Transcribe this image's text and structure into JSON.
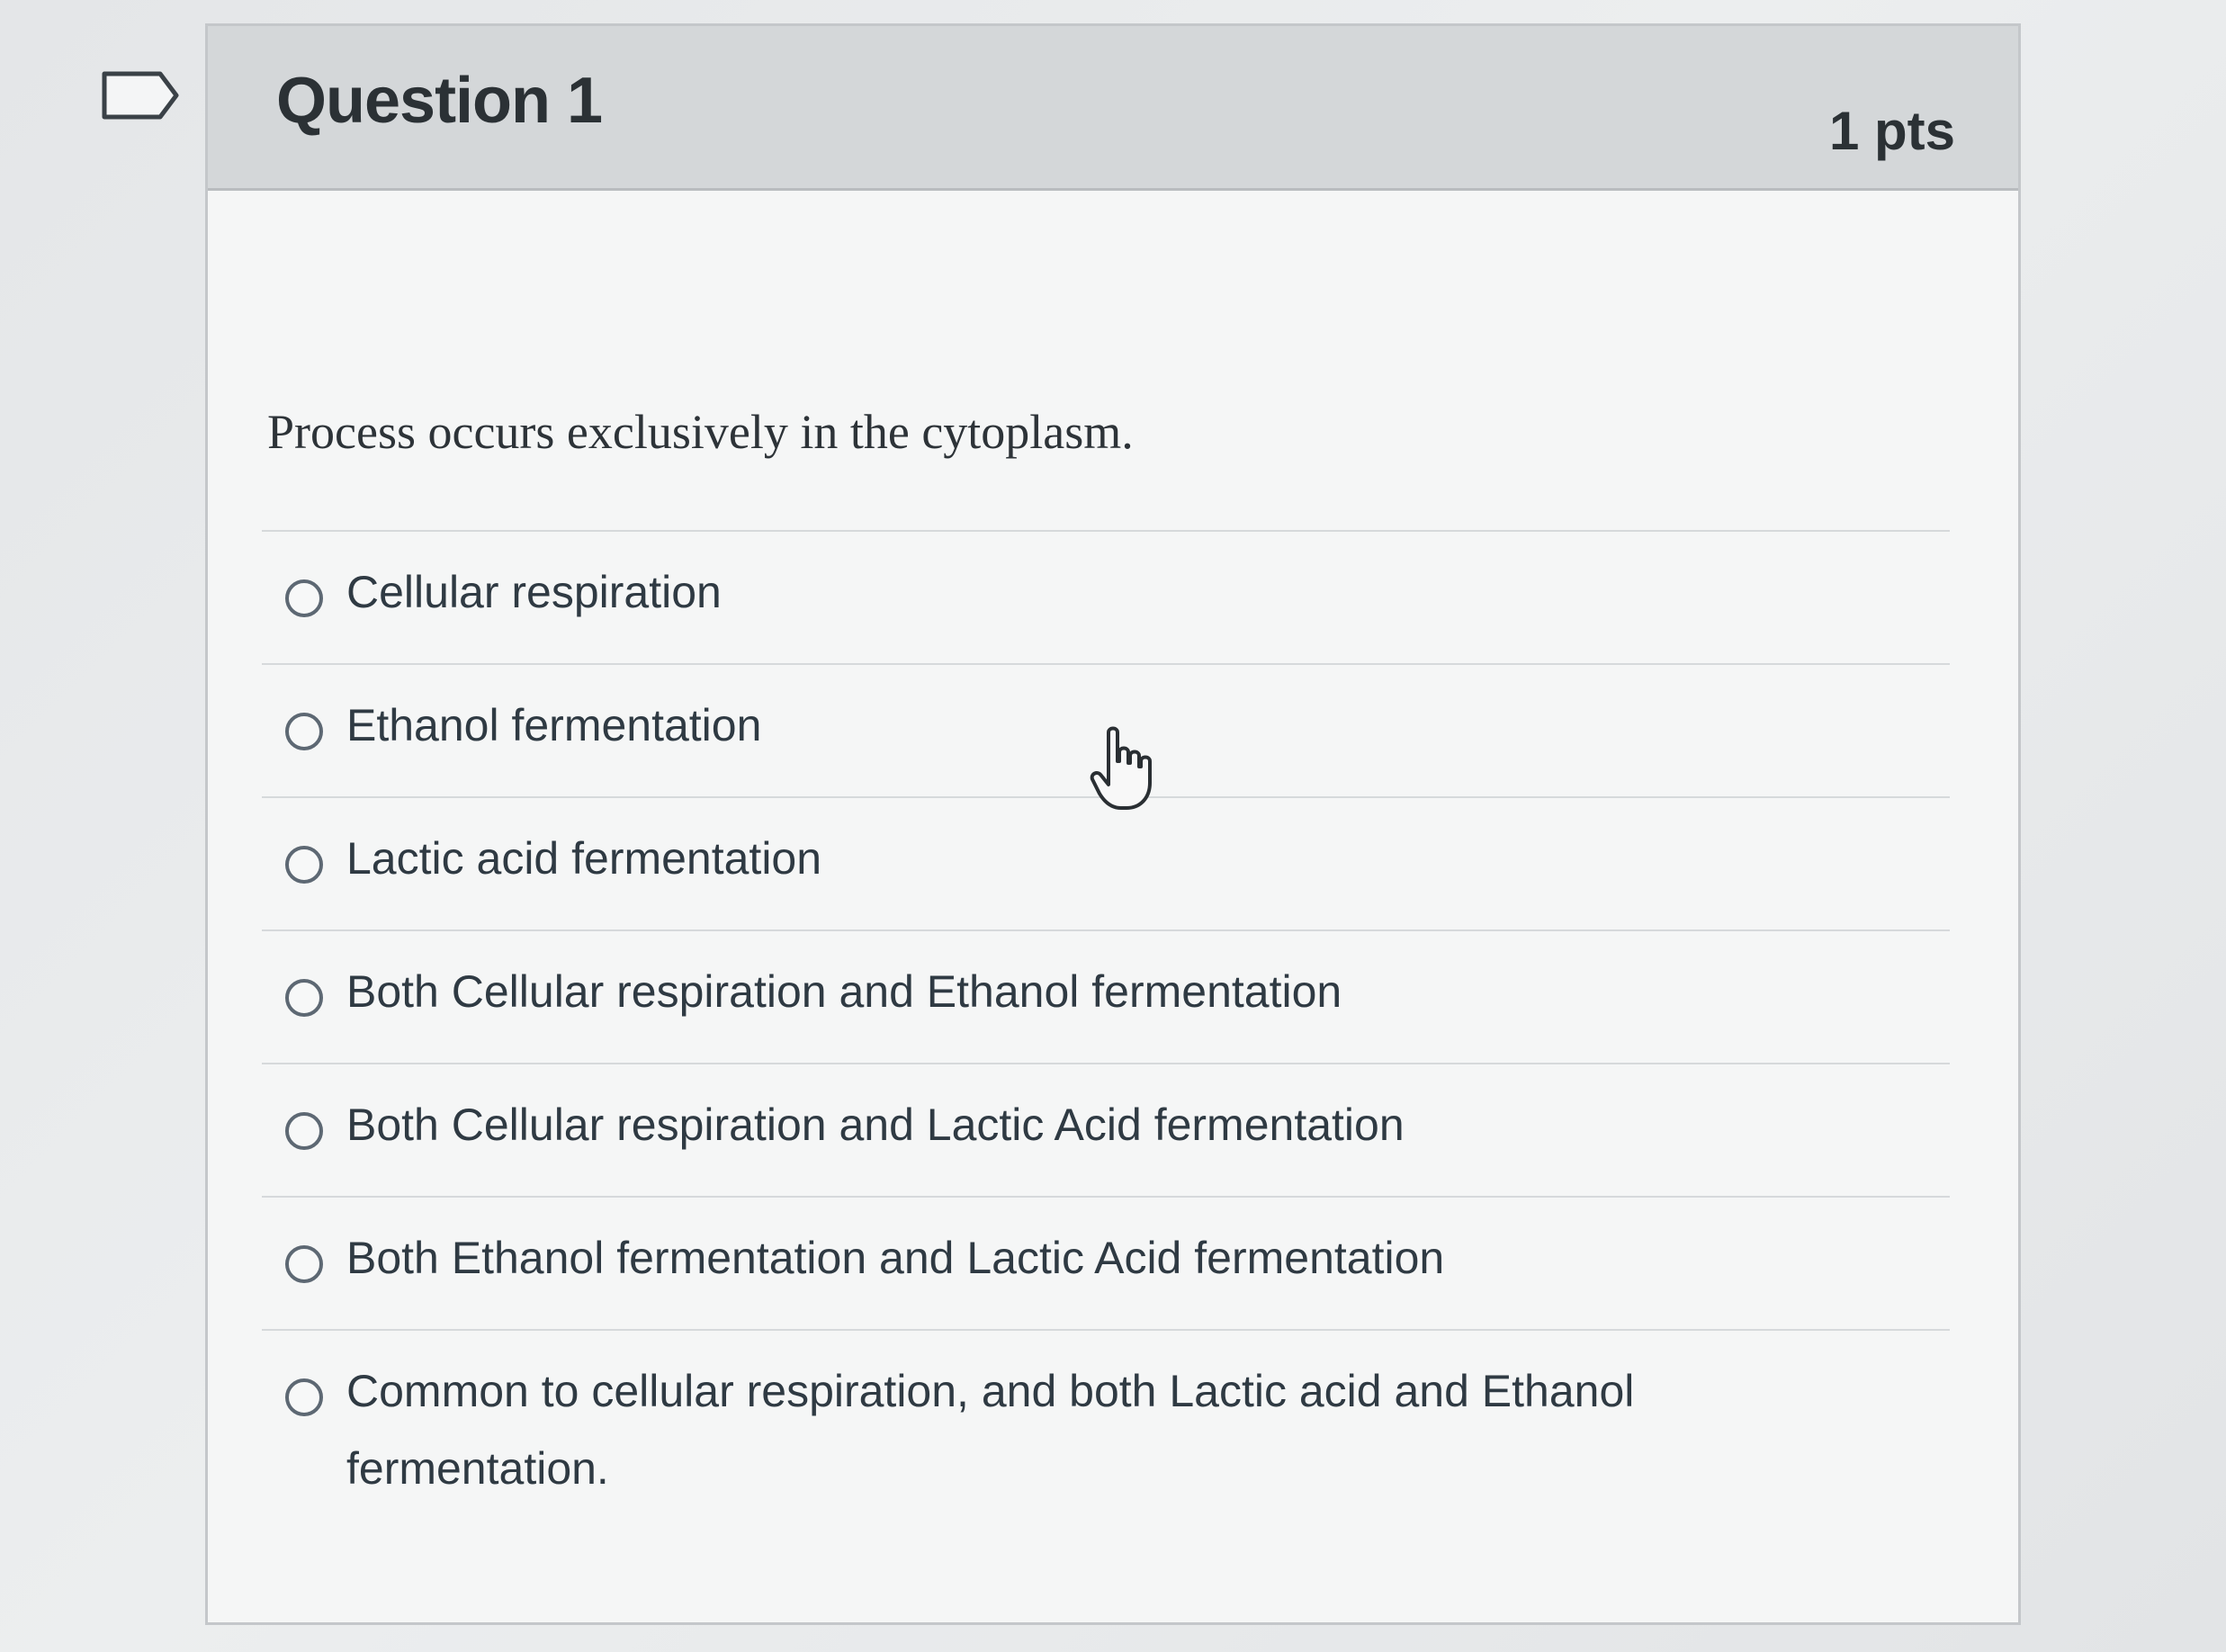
{
  "question": {
    "title": "Question 1",
    "points": "1 pts",
    "text": "Process occurs exclusively in the cytoplasm.",
    "answers": [
      {
        "label": "Cellular respiration"
      },
      {
        "label": "Ethanol fermentation"
      },
      {
        "label": "Lactic acid fermentation"
      },
      {
        "label": "Both Cellular respiration and Ethanol fermentation"
      },
      {
        "label": "Both Cellular respiration and Lactic Acid fermentation"
      },
      {
        "label": "Both Ethanol fermentation and Lactic Acid fermentation"
      },
      {
        "label": "Common to cellular respiration, and both Lactic acid and Ethanol fermentation."
      }
    ]
  },
  "icons": {
    "flag": "flag-marker-icon",
    "cursor": "hand-pointer-icon"
  },
  "colors": {
    "header_bg": "#d4d7d9",
    "card_bg": "#f5f6f6",
    "text": "#2d3b45",
    "radio_border": "#5d6873"
  }
}
